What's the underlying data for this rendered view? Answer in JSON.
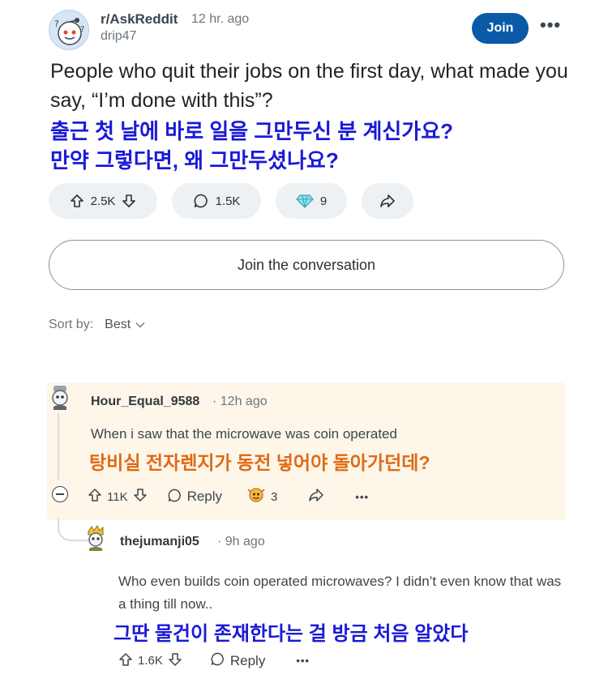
{
  "post": {
    "subreddit": "r/AskReddit",
    "time": "12 hr. ago",
    "author": "drip47",
    "join_label": "Join",
    "more_label": "•••",
    "title_en": "People who quit their jobs on the first day, what made you say, “I’m done with this”?",
    "title_ko_line1": "출근 첫 날에 바로 일을 그만두신 분 계신가요?",
    "title_ko_line2": "만약 그렇다면, 왜 그만두셨나요?",
    "votes": "2.5K",
    "comments": "1.5K",
    "awards": "9",
    "join_conversation": "Join the conversation"
  },
  "sort": {
    "label": "Sort by:",
    "value": "Best"
  },
  "comment1": {
    "user": "Hour_Equal_9588",
    "time": "12h ago",
    "text_en": "When i saw that the microwave was coin operated",
    "text_ko": "탕비실 전자렌지가 동전 넣어야 돌아가던데?",
    "votes": "11K",
    "reply_label": "Reply",
    "awards": "3",
    "more_label": "•••"
  },
  "comment2": {
    "user": "thejumanji05",
    "time": "9h ago",
    "text_en": "Who even builds coin operated microwaves? I didn’t even know that was a thing till now..",
    "text_ko": "그딴 물건이 존재한다는 걸 방금 처음 알았다",
    "votes": "1.6K",
    "reply_label": "Reply",
    "more_label": "•••"
  },
  "colors": {
    "join_button": "#0a5aa8",
    "korean_blue": "#1a1ad8",
    "korean_orange": "#e06a14",
    "highlight_bg": "#fdf6e9"
  },
  "icons": [
    "subreddit-avatar-icon",
    "upvote-icon",
    "downvote-icon",
    "comment-icon",
    "award-icon",
    "share-icon",
    "chevron-down-icon",
    "collapse-icon",
    "user-avatar-icon",
    "more-icon"
  ]
}
